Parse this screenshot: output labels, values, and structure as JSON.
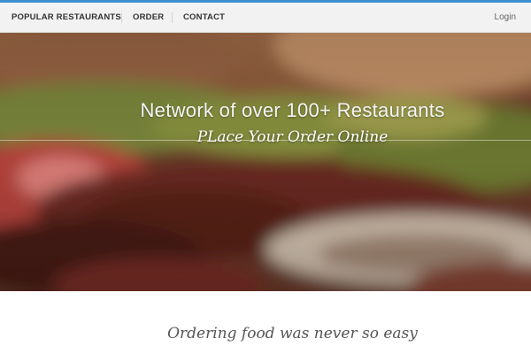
{
  "nav": {
    "items": [
      {
        "label": "POPULAR RESTAURANTS"
      },
      {
        "label": "ORDER"
      },
      {
        "label": "CONTACT"
      }
    ],
    "login_label": "Login"
  },
  "hero": {
    "title": "Network of over 100+ Restaurants",
    "subtitle": "PLace Your Order Online"
  },
  "content": {
    "tagline": "Ordering food was never so easy"
  },
  "colors": {
    "accent_bar": "#3d8fd0",
    "navbar_bg": "#f2f2f2"
  }
}
